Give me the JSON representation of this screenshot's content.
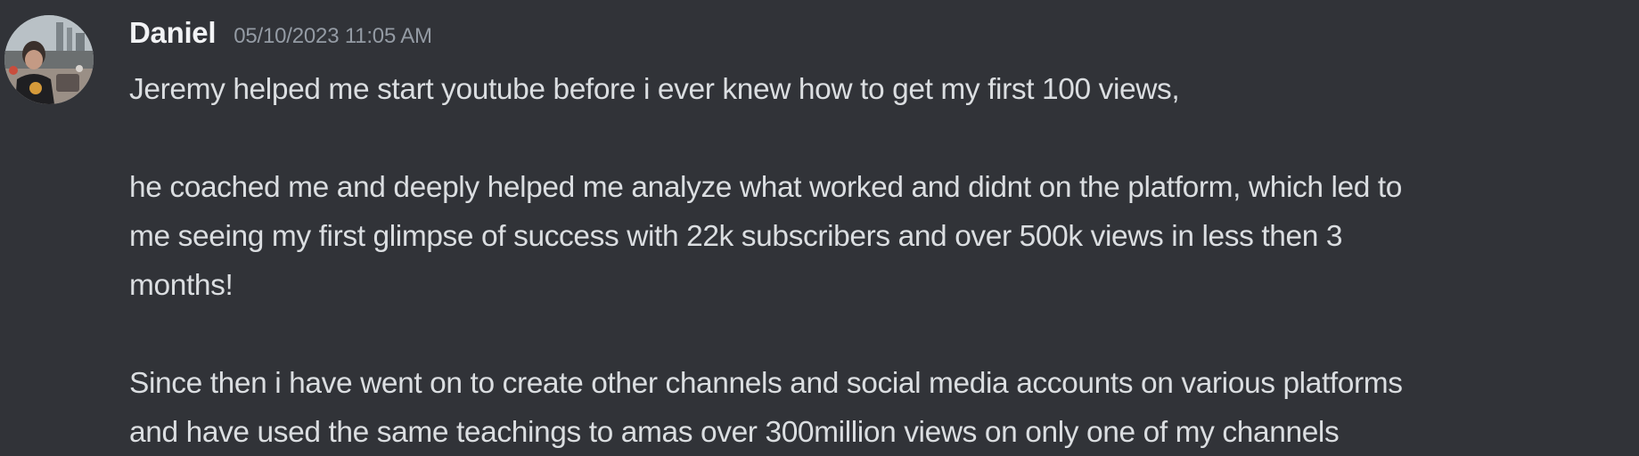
{
  "message": {
    "author": "Daniel",
    "timestamp": "05/10/2023 11:05 AM",
    "avatar_icon": "user-avatar-photo",
    "lines": [
      "Jeremy helped me start youtube before i ever knew how to get my first 100 views,",
      "",
      "he coached me and deeply helped me analyze what worked and didnt on the platform, which led to",
      "me seeing my first glimpse of success with 22k subscribers and over 500k views in less then 3",
      "months!",
      "",
      "Since then i have went on to create other channels and social media accounts on various platforms",
      "and have used the same teachings to amas over 300million views on only one of my channels"
    ]
  },
  "colors": {
    "background": "#313338",
    "author": "#f2f3f5",
    "timestamp": "#949ba4",
    "text": "#dbdee1"
  }
}
